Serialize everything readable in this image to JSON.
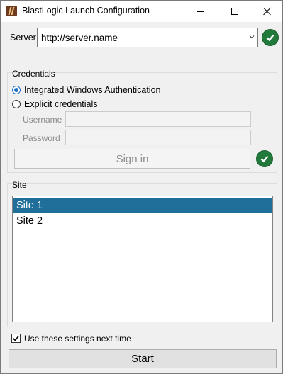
{
  "window": {
    "title": "BlastLogic Launch Configuration",
    "icons": [
      "blastlogic-app-icon",
      "minimize-icon",
      "maximize-icon",
      "close-icon"
    ]
  },
  "server": {
    "label": "Server",
    "value": "http://server.name",
    "status_icon": "check-circle-icon",
    "status_color": "#217a3b"
  },
  "credentials": {
    "caption": "Credentials",
    "options": [
      {
        "label": "Integrated Windows Authentication",
        "selected": true
      },
      {
        "label": "Explicit credentials",
        "selected": false
      }
    ],
    "username_label": "Username",
    "username_value": "",
    "password_label": "Password",
    "password_value": "",
    "signin_label": "Sign in",
    "status_icon": "check-circle-icon"
  },
  "site": {
    "caption": "Site",
    "items": [
      {
        "label": "Site 1",
        "selected": true
      },
      {
        "label": "Site 2",
        "selected": false
      }
    ],
    "selection_color": "#1f6f9a"
  },
  "footer": {
    "remember_label": "Use these settings next time",
    "remember_checked": true,
    "start_label": "Start"
  }
}
